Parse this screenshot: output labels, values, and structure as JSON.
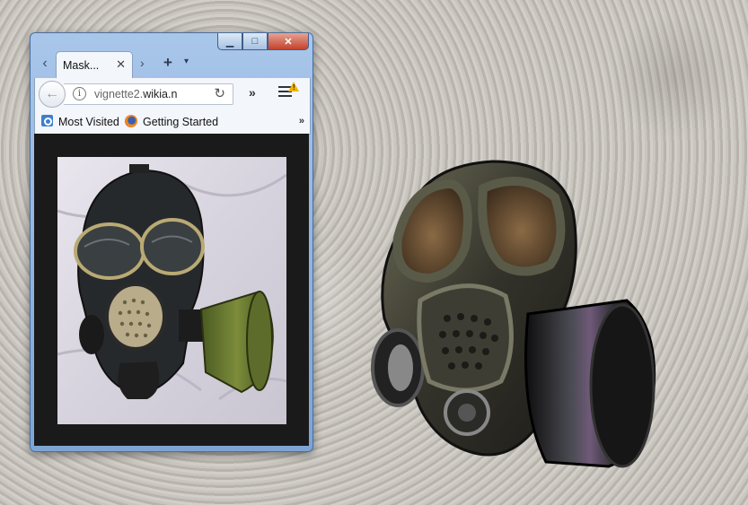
{
  "window": {
    "caption": {
      "minimize": "▁",
      "maximize": "□",
      "close": "✕"
    },
    "tab": {
      "title": "Mask...",
      "close_glyph": "✕"
    },
    "tab_strip": {
      "back_glyph": "‹",
      "forward_glyph": "›",
      "new_tab_glyph": "+",
      "list_glyph": "▾"
    },
    "nav": {
      "back_glyph": "←",
      "url_host": "vignette2.",
      "url_domain": "wikia.n",
      "reload_glyph": "↻",
      "overflow_glyph": "»",
      "info_glyph": "i",
      "warn_glyph": "!"
    },
    "bookmarks": [
      {
        "label": "Most Visited",
        "icon": "most-visited-icon"
      },
      {
        "label": "Getting Started",
        "icon": "firefox-icon"
      }
    ],
    "bookmarks_overflow": "»"
  },
  "colors": {
    "titlebar": "#7ea4d3",
    "close_button": "#c4422d",
    "toolbar": "#f3f6fb",
    "content_bg": "#1a1a1a",
    "warning": "#f0b400"
  }
}
